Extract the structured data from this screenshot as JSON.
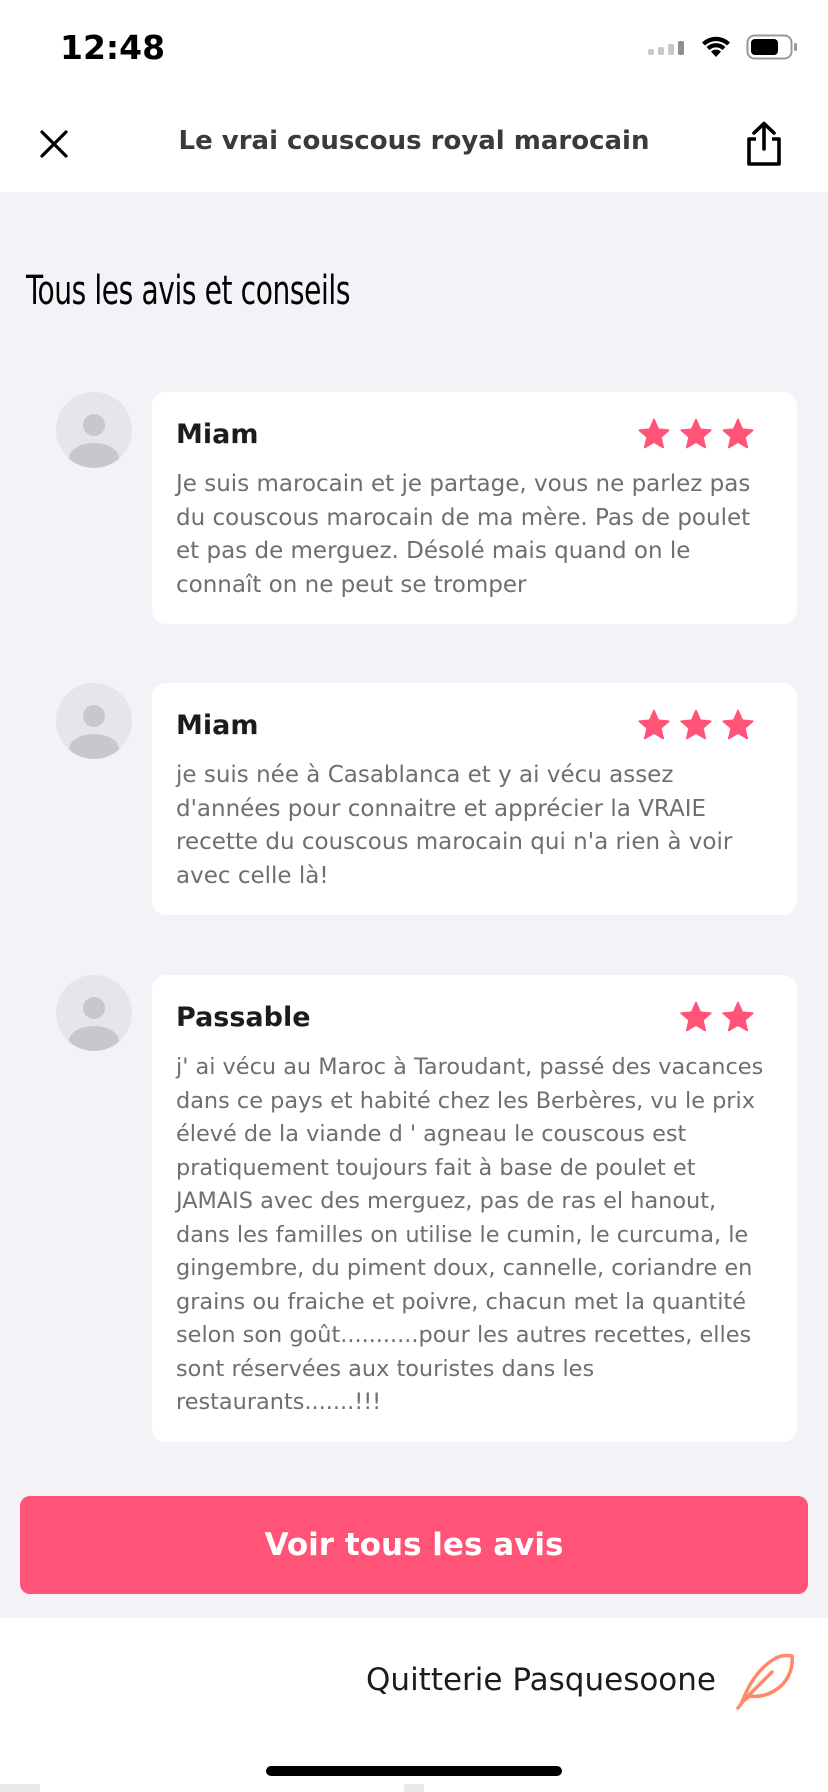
{
  "status_bar": {
    "time": "12:48"
  },
  "nav": {
    "title": "Le vrai couscous royal marocain"
  },
  "section": {
    "title": "Tous les avis et conseils"
  },
  "reviews": [
    {
      "title": "Miam",
      "rating": 3,
      "text": "Je suis marocain et je partage, vous ne parlez pas du couscous marocain de ma mère. Pas de poulet et pas de merguez. Désolé mais quand on le connaît on ne peut se tromper"
    },
    {
      "title": "Miam",
      "rating": 3,
      "text": "je suis née à Casablanca et y ai vécu assez d'années pour connaitre et apprécier la VRAIE recette du couscous marocain qui n'a rien à voir avec celle là!"
    },
    {
      "title": "Passable",
      "rating": 2,
      "text": "j' ai vécu au Maroc à Taroudant, passé des vacances dans ce pays et habité chez les Berbères, vu le prix élevé de la viande d ' agneau le couscous est pratiquement toujours fait à base de poulet et JAMAIS avec des merguez, pas de ras el hanout, dans les familles on utilise le cumin, le curcuma, le gingembre, du piment doux, cannelle, coriandre en grains ou fraiche et poivre, chacun met la quantité selon son goût...........pour les autres recettes, elles sont réservées aux touristes dans les restaurants.......!!!"
    }
  ],
  "cta": {
    "label": "Voir tous les avis"
  },
  "author": {
    "name": "Quitterie Pasquesoone"
  },
  "colors": {
    "accent": "#ff5478",
    "star": "#ff5478",
    "author_icon": "#ff8a65"
  },
  "icons": {
    "close": "close-icon",
    "share": "share-icon",
    "star": "star-icon",
    "author": "feather-icon"
  }
}
